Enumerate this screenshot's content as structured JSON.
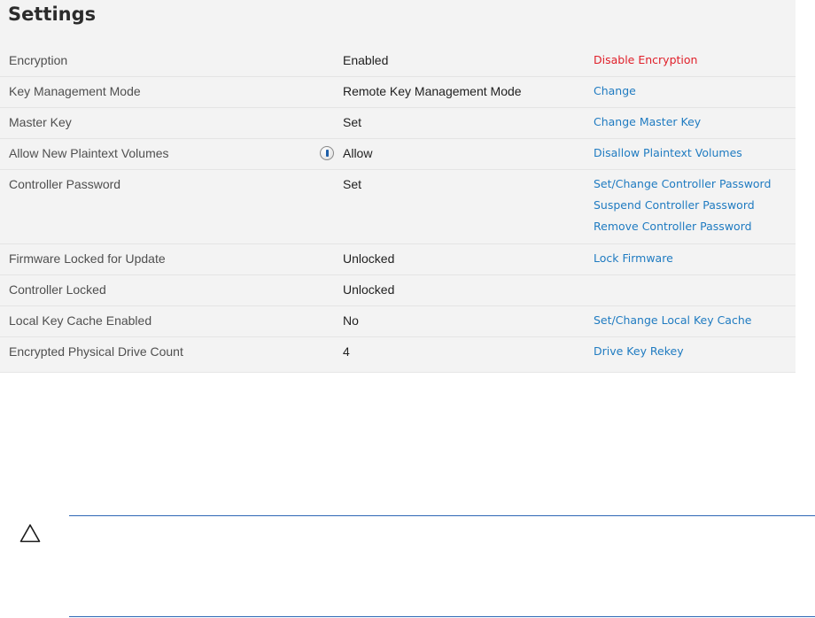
{
  "settings": {
    "title": "Settings",
    "rows": [
      {
        "label": "Encryption",
        "value": "Enabled",
        "actions": [
          {
            "label": "Disable Encryption"
          }
        ]
      },
      {
        "label": "Key Management Mode",
        "value": "Remote Key Management Mode",
        "actions": [
          {
            "label": "Change"
          }
        ]
      },
      {
        "label": "Master Key",
        "value": "Set",
        "actions": [
          {
            "label": "Change Master Key"
          }
        ]
      },
      {
        "label": "Allow New Plaintext Volumes",
        "value": "Allow",
        "icon": "info-icon",
        "actions": [
          {
            "label": "Disallow Plaintext Volumes"
          }
        ]
      },
      {
        "label": "Controller Password",
        "value": "Set",
        "actions": [
          {
            "label": "Set/Change Controller Password"
          },
          {
            "label": "Suspend Controller Password"
          },
          {
            "label": "Remove Controller Password"
          }
        ]
      },
      {
        "label": "Firmware Locked for Update",
        "value": "Unlocked",
        "actions": [
          {
            "label": "Lock Firmware"
          }
        ]
      },
      {
        "label": "Controller Locked",
        "value": "Unlocked",
        "actions": []
      },
      {
        "label": "Local Key Cache Enabled",
        "value": "No",
        "actions": [
          {
            "label": "Set/Change Local Key Cache"
          }
        ]
      },
      {
        "label": "Encrypted Physical Drive Count",
        "value": "4",
        "actions": [
          {
            "label": "Drive Key Rekey"
          }
        ]
      }
    ]
  },
  "caution": {
    "icon": "warning-triangle-icon"
  },
  "colors": {
    "link": "#1f7bc1",
    "danger": "#e0202a",
    "rule": "#2e67b5",
    "panel": "#f3f3f3"
  }
}
